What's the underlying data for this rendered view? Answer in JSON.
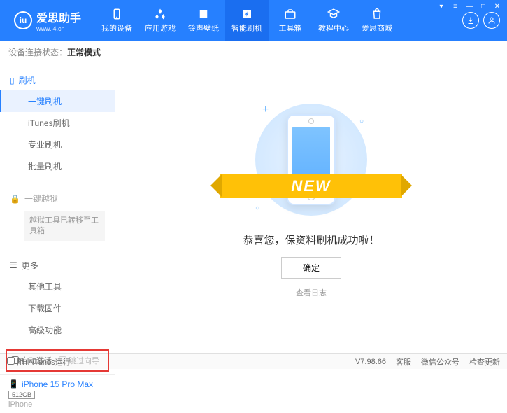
{
  "app": {
    "name": "爱思助手",
    "url": "www.i4.cn"
  },
  "nav": [
    {
      "label": "我的设备",
      "icon": "device"
    },
    {
      "label": "应用游戏",
      "icon": "apps"
    },
    {
      "label": "铃声壁纸",
      "icon": "ringtone"
    },
    {
      "label": "智能刷机",
      "icon": "flash",
      "active": true
    },
    {
      "label": "工具箱",
      "icon": "toolbox"
    },
    {
      "label": "教程中心",
      "icon": "tutorial"
    },
    {
      "label": "爱思商城",
      "icon": "store"
    }
  ],
  "connection": {
    "label": "设备连接状态：",
    "value": "正常模式"
  },
  "sidebar": {
    "flash": {
      "title": "刷机",
      "items": [
        "一键刷机",
        "iTunes刷机",
        "专业刷机",
        "批量刷机"
      ],
      "active_index": 0
    },
    "jailbreak": {
      "title": "一键越狱",
      "note": "越狱工具已转移至工具箱"
    },
    "more": {
      "title": "更多",
      "items": [
        "其他工具",
        "下载固件",
        "高级功能"
      ]
    }
  },
  "options": {
    "auto_activate": "自动激活",
    "skip_guide": "跳过向导"
  },
  "device": {
    "name": "iPhone 15 Pro Max",
    "storage": "512GB",
    "type": "iPhone"
  },
  "main": {
    "banner": "NEW",
    "message": "恭喜您，保资料刷机成功啦！",
    "ok": "确定",
    "view_log": "查看日志"
  },
  "footer": {
    "block_itunes": "阻止iTunes运行",
    "version": "V7.98.66",
    "links": [
      "客服",
      "微信公众号",
      "检查更新"
    ]
  }
}
